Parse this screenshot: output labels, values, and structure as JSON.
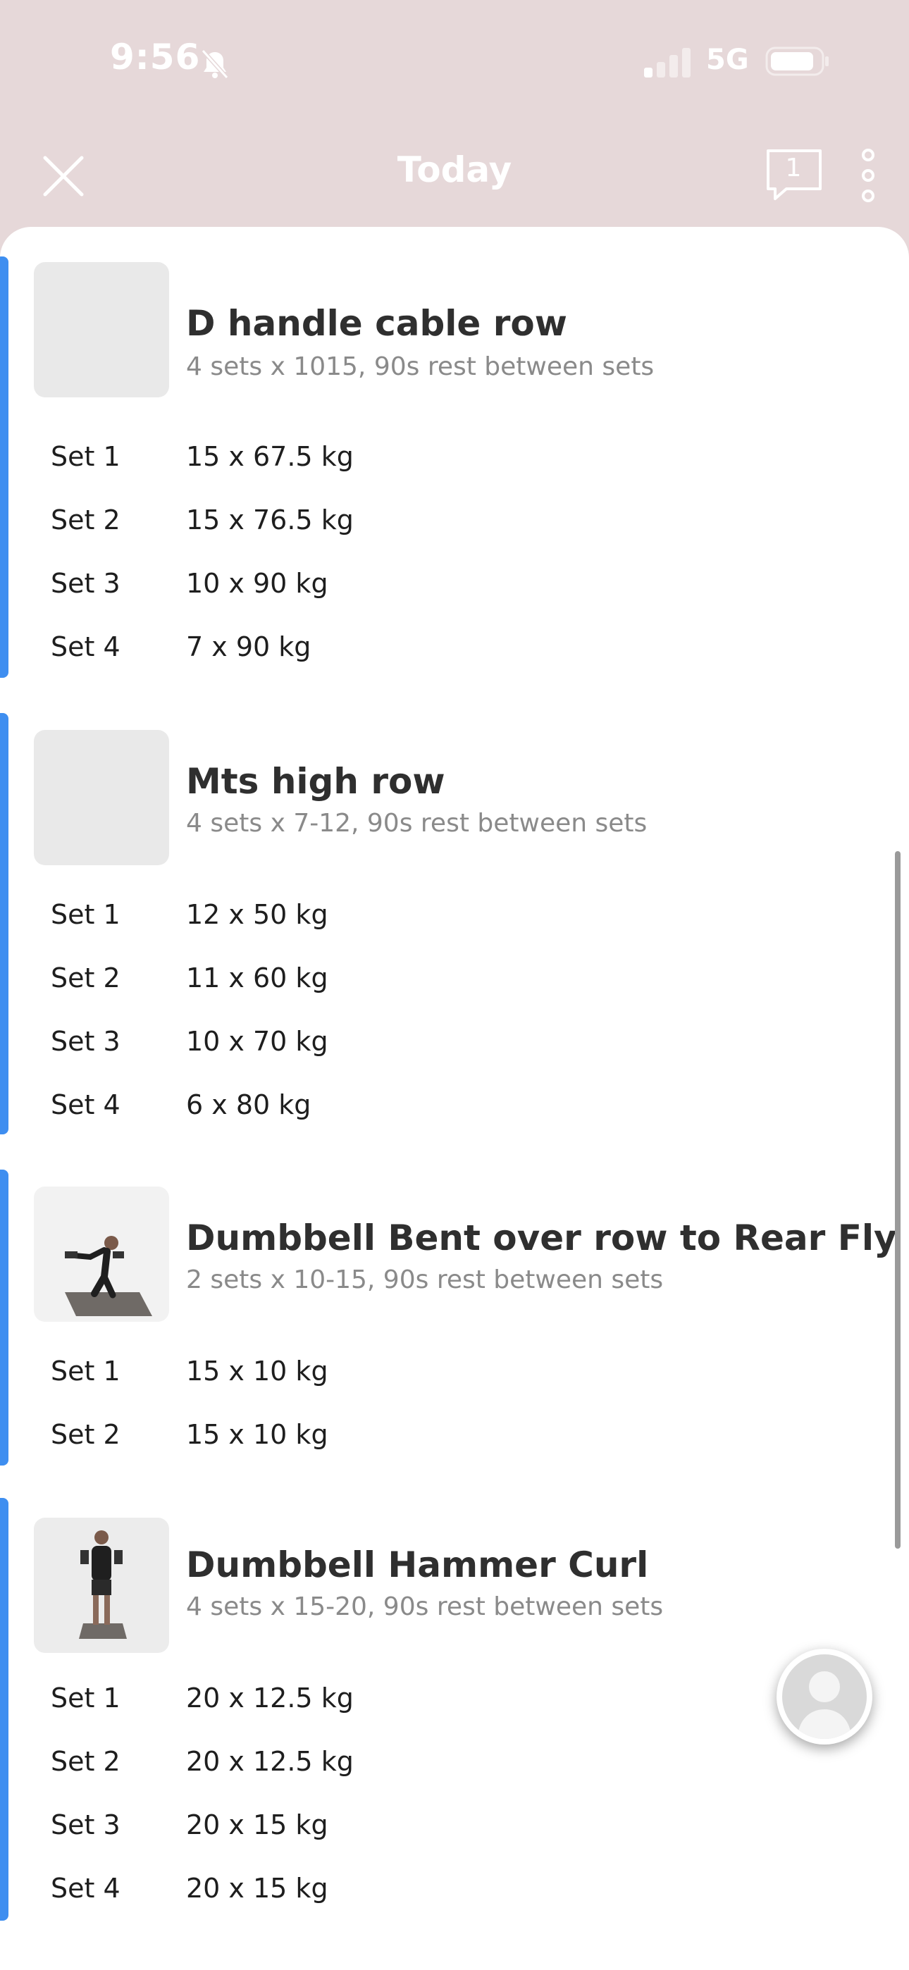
{
  "status_bar": {
    "time": "9:56",
    "network": "5G"
  },
  "header": {
    "title": "Today",
    "chat_badge": "1"
  },
  "exercises": [
    {
      "name": "D handle cable row",
      "description": "4 sets x 1015, 90s rest between sets",
      "sets": [
        {
          "label": "Set 1",
          "value": "15 x 67.5 kg"
        },
        {
          "label": "Set 2",
          "value": "15 x 76.5 kg"
        },
        {
          "label": "Set 3",
          "value": "10 x 90 kg"
        },
        {
          "label": "Set 4",
          "value": "7 x 90 kg"
        }
      ]
    },
    {
      "name": "Mts high row",
      "description": "4 sets x 7-12, 90s rest between sets",
      "sets": [
        {
          "label": "Set 1",
          "value": "12 x 50 kg"
        },
        {
          "label": "Set 2",
          "value": "11 x 60 kg"
        },
        {
          "label": "Set 3",
          "value": "10 x 70 kg"
        },
        {
          "label": "Set 4",
          "value": "6 x 80 kg"
        }
      ]
    },
    {
      "name": "Dumbbell Bent over row to Rear Fly",
      "description": "2 sets x 10-15, 90s rest between sets",
      "sets": [
        {
          "label": "Set 1",
          "value": "15 x 10 kg"
        },
        {
          "label": "Set 2",
          "value": "15 x 10 kg"
        }
      ]
    },
    {
      "name": "Dumbbell Hammer Curl",
      "description": "4 sets x 15-20, 90s rest between sets",
      "sets": [
        {
          "label": "Set 1",
          "value": "20 x 12.5 kg"
        },
        {
          "label": "Set 2",
          "value": "20 x 12.5 kg"
        },
        {
          "label": "Set 3",
          "value": "20 x 15 kg"
        },
        {
          "label": "Set 4",
          "value": "20 x 15 kg"
        }
      ]
    }
  ],
  "colors": {
    "accent": "#3e8ef0",
    "header_bg": "#e6d8d9"
  },
  "icons": [
    "bell-slash-icon",
    "signal-icon",
    "battery-icon",
    "close-icon",
    "chat-icon",
    "more-vertical-icon",
    "avatar-icon"
  ]
}
